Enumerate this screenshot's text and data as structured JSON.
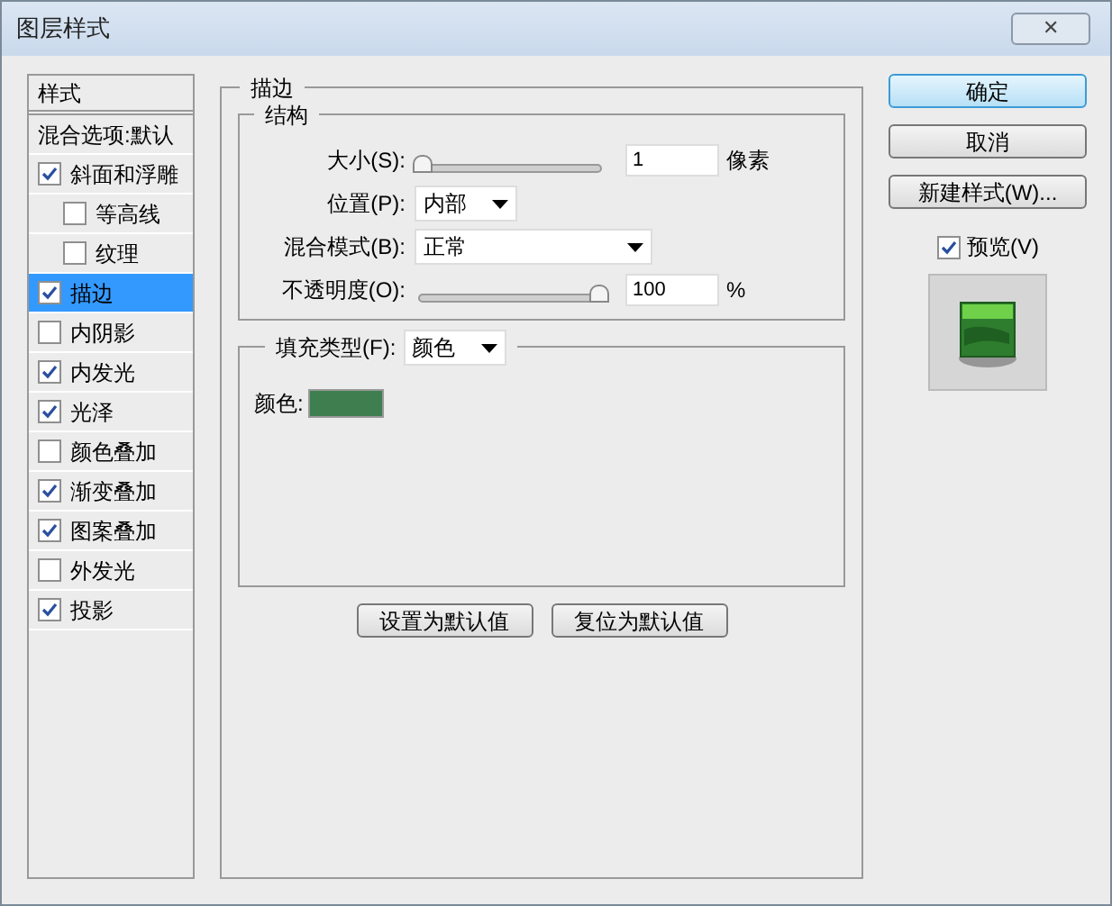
{
  "window": {
    "title": "图层样式",
    "close": "✕"
  },
  "sidebar": {
    "header": "样式",
    "blending": "混合选项:默认",
    "items": [
      {
        "label": "斜面和浮雕",
        "checked": true,
        "selected": false,
        "children": [
          {
            "label": "等高线",
            "checked": false,
            "selected": false
          },
          {
            "label": "纹理",
            "checked": false,
            "selected": false
          }
        ]
      },
      {
        "label": "描边",
        "checked": true,
        "selected": true
      },
      {
        "label": "内阴影",
        "checked": false,
        "selected": false
      },
      {
        "label": "内发光",
        "checked": true,
        "selected": false
      },
      {
        "label": "光泽",
        "checked": true,
        "selected": false
      },
      {
        "label": "颜色叠加",
        "checked": false,
        "selected": false
      },
      {
        "label": "渐变叠加",
        "checked": true,
        "selected": false
      },
      {
        "label": "图案叠加",
        "checked": true,
        "selected": false
      },
      {
        "label": "外发光",
        "checked": false,
        "selected": false
      },
      {
        "label": "投影",
        "checked": true,
        "selected": false
      }
    ]
  },
  "panel": {
    "title": "描边",
    "structure": {
      "title": "结构",
      "rows": [
        {
          "kind": "slider",
          "label": "大小(S):",
          "level": 0.02,
          "value": "1",
          "unit": "像素"
        },
        {
          "kind": "select",
          "label": "位置(P):",
          "value": "内部",
          "wide": false
        },
        {
          "kind": "select",
          "label": "混合模式(B):",
          "value": "正常",
          "wide": true
        },
        {
          "kind": "slider",
          "label": "不透明度(O):",
          "level": 1,
          "value": "100",
          "unit": "%"
        }
      ]
    },
    "fill": {
      "label": "填充类型(F):",
      "value": "颜色",
      "color_label": "颜色:",
      "color": "#3f7f4f"
    },
    "buttons": [
      "设置为默认值",
      "复位为默认值"
    ]
  },
  "actions": {
    "buttons": [
      {
        "label": "确定",
        "default": true
      },
      {
        "label": "取消",
        "default": false
      },
      {
        "label": "新建样式(W)...",
        "default": false
      }
    ],
    "preview": {
      "label": "预览(V)",
      "checked": true
    }
  }
}
